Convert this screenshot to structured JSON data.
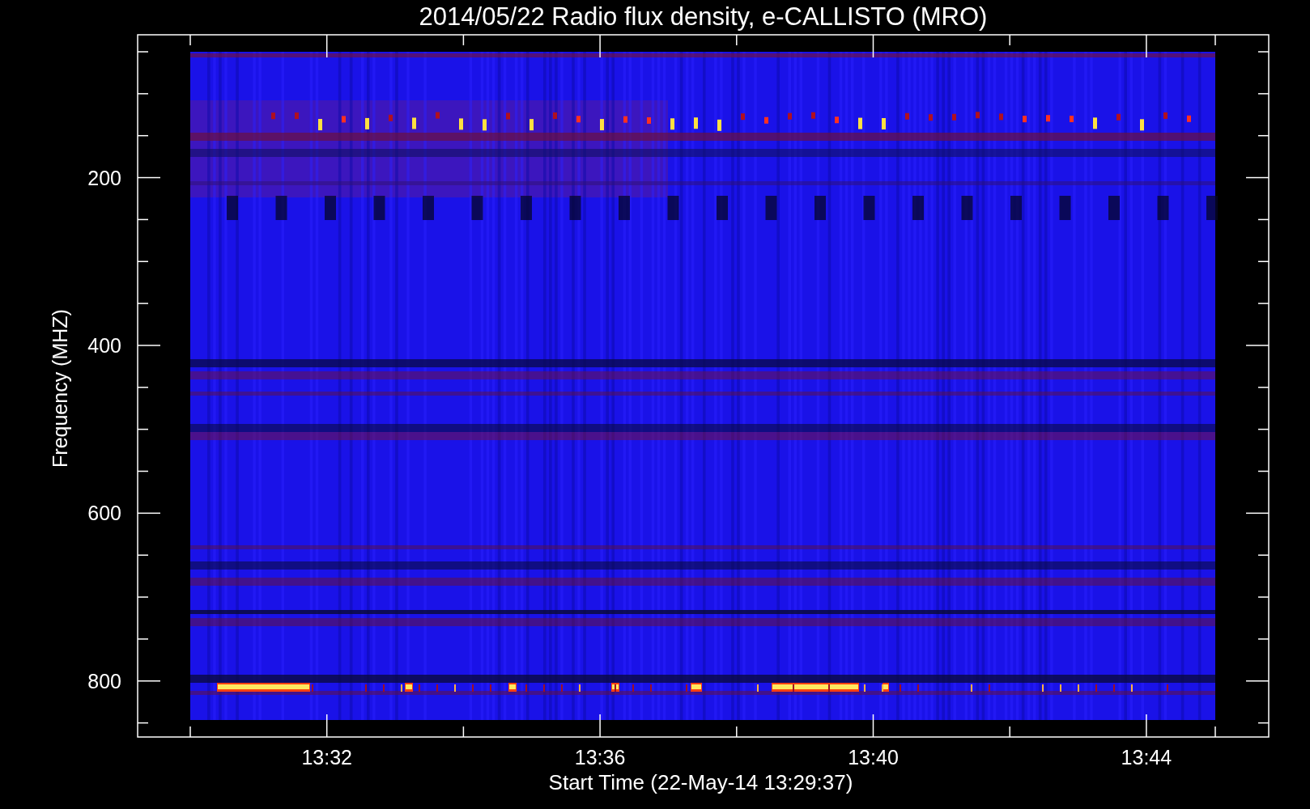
{
  "title": "2014/05/22  Radio flux density, e-CALLISTO (MRO)",
  "y_axis": {
    "label": "Frequency (MHZ)",
    "tick_labels": [
      "200",
      "400",
      "600",
      "800"
    ]
  },
  "x_axis": {
    "label": "Start Time (22-May-14 13:29:37)",
    "tick_labels": [
      "13:32",
      "13:36",
      "13:40",
      "13:44"
    ]
  }
}
